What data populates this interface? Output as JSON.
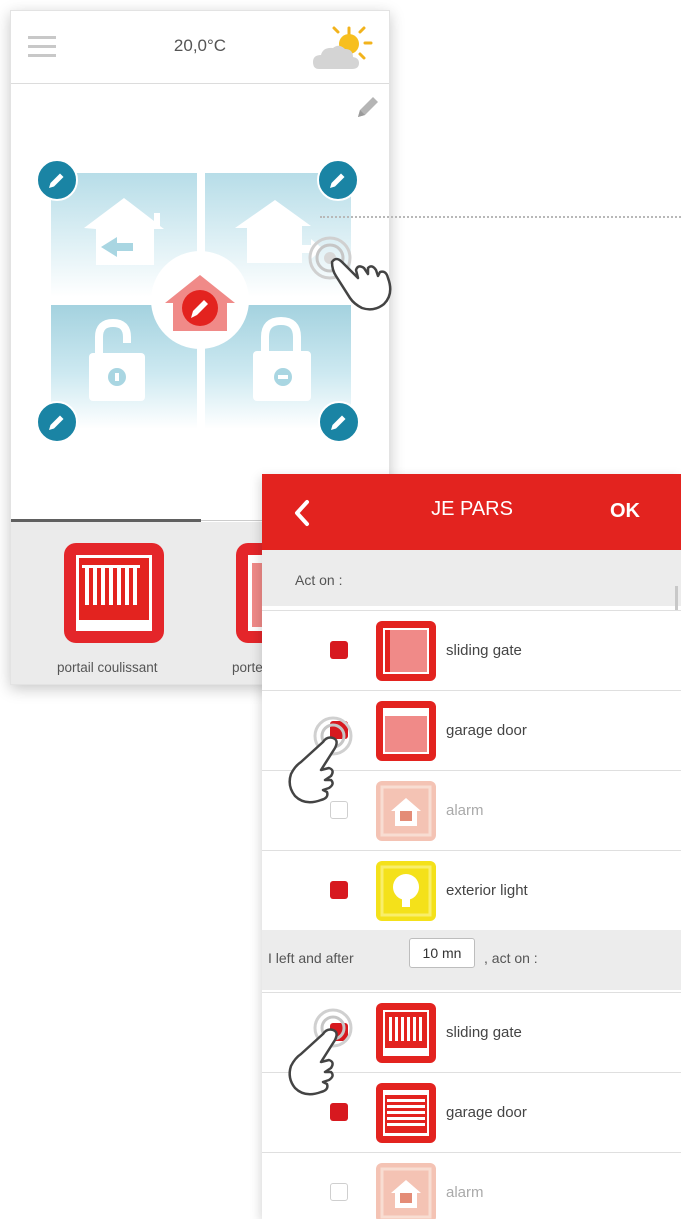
{
  "main_screen": {
    "temperature": "20,0°C",
    "icons": {
      "menu": "hamburger-menu-icon",
      "weather": "sun-cloud-icon",
      "edit": "pencil-icon"
    },
    "scenario_tiles": [
      "arrive-home",
      "leave-home",
      "unlock",
      "lock"
    ],
    "devices": [
      {
        "label": "portail coulissant"
      },
      {
        "label": "porte"
      }
    ]
  },
  "panel": {
    "title": "JE PARS",
    "ok_label": "OK",
    "section1": {
      "label": "Act on :"
    },
    "section2": {
      "prefix": "I left and after",
      "minutes": "10 mn",
      "suffix": ", act on :"
    },
    "rows_now": [
      {
        "label": "sliding gate",
        "checked": true
      },
      {
        "label": "garage door",
        "checked": true
      },
      {
        "label": "alarm",
        "checked": false
      },
      {
        "label": "exterior light",
        "checked": true
      }
    ],
    "rows_later": [
      {
        "label": "sliding gate",
        "checked": true
      },
      {
        "label": "garage door",
        "checked": true
      },
      {
        "label": "alarm",
        "checked": false
      }
    ]
  },
  "colors": {
    "accent_red": "#e3231f",
    "teal": "#1a84a4",
    "light_blue": "#b7dde8",
    "yellow": "#f4e11a"
  }
}
